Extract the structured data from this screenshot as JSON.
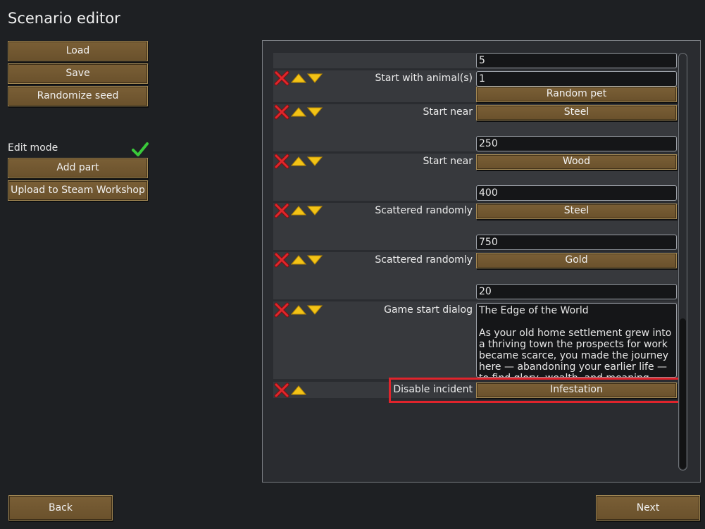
{
  "title": "Scenario editor",
  "left_buttons": {
    "load": "Load",
    "save": "Save",
    "randomize_seed": "Randomize seed",
    "edit_mode_label": "Edit mode",
    "add_part": "Add part",
    "upload": "Upload to Steam Workshop"
  },
  "parts": {
    "top_value": "5",
    "animals": {
      "label": "Start with animal(s)",
      "value": "1",
      "button": "Random pet"
    },
    "start_near_1": {
      "label": "Start near",
      "button": "Steel",
      "value": "250"
    },
    "start_near_2": {
      "label": "Start near",
      "button": "Wood",
      "value": "400"
    },
    "scattered_1": {
      "label": "Scattered randomly",
      "button": "Steel",
      "value": "750"
    },
    "scattered_2": {
      "label": "Scattered randomly",
      "button": "Gold",
      "value": "20"
    },
    "dialog": {
      "label": "Game start dialog",
      "title_line": "The Edge of the World",
      "body": "As your old home settlement grew into a thriving town the prospects for work became scarce, you made the journey here — abandoning your earlier life — to find glory, wealth, and meaning."
    },
    "disable_incident": {
      "label": "Disable incident",
      "button": "Infestation"
    }
  },
  "footer": {
    "back": "Back",
    "next": "Next"
  },
  "colors": {
    "accent_check": "#3ac93a",
    "highlight": "#e0242c",
    "button": "#6e552f"
  },
  "icons": {
    "remove": "red-x-icon",
    "move_up": "up-arrow-icon",
    "move_down": "down-arrow-icon",
    "edit_mode": "checkmark-icon"
  }
}
